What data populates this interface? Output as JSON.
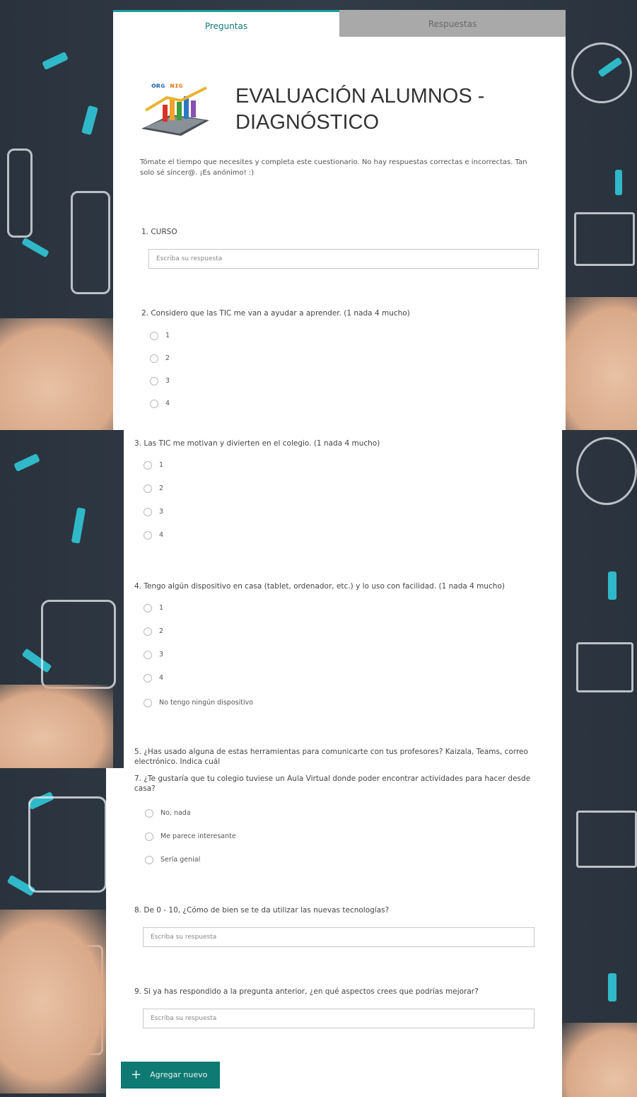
{
  "tabs": {
    "questions": "Preguntas",
    "responses": "Respuestas"
  },
  "form": {
    "title_line1": "EVALUACIÓN ALUMNOS -",
    "title_line2": "DIAGNÓSTICO",
    "description": "Tómate el tiempo que necesites y completa este cuestionario. No hay respuestas correctas e incorrectas. Tan solo sé sincer@. ¡Es anónimo! :)"
  },
  "questions": {
    "q1": {
      "text": "1. CURSO",
      "placeholder": "Escriba su respuesta"
    },
    "q2": {
      "text": "2. Considero que las TIC me van a ayudar a aprender. (1 nada 4 mucho)",
      "options": [
        "1",
        "2",
        "3",
        "4"
      ]
    },
    "q3": {
      "text": "3. Las TIC me motivan y divierten en el colegio. (1 nada 4 mucho)",
      "options": [
        "1",
        "2",
        "3",
        "4"
      ]
    },
    "q4": {
      "text": "4. Tengo algún dispositivo en casa (tablet, ordenador, etc.) y lo uso con facilidad. (1 nada 4 mucho)",
      "options": [
        "1",
        "2",
        "3",
        "4",
        "No tengo ningún dispositivo"
      ]
    },
    "q5": {
      "text": "5. ¿Has usado alguna de estas herramientas para comunicarte con tus profesores? Kaizala, Teams, correo electrónico. Indica cuál"
    },
    "q7": {
      "text": "7. ¿Te gustaría que tu colegio tuviese un Aula Virtual donde poder encontrar actividades para hacer desde casa?",
      "options": [
        "No, nada",
        "Me parece interesante",
        "Sería genial"
      ]
    },
    "q8": {
      "text": "8. De 0 - 10, ¿Cómo de bien se te da utilizar las nuevas tecnologías?",
      "placeholder": "Escriba su respuesta"
    },
    "q9": {
      "text": "9. Si ya has respondido a la pregunta anterior, ¿en qué aspectos crees que podrías mejorar?",
      "placeholder": "Escriba su respuesta"
    }
  },
  "add_button": {
    "label": "Agregar nuevo",
    "icon": "plus-icon"
  },
  "colors": {
    "accent": "#0e7a73",
    "tab_active": "#1b9b9b",
    "background": "#2c3540",
    "decor_teal": "#2fb8c8"
  }
}
